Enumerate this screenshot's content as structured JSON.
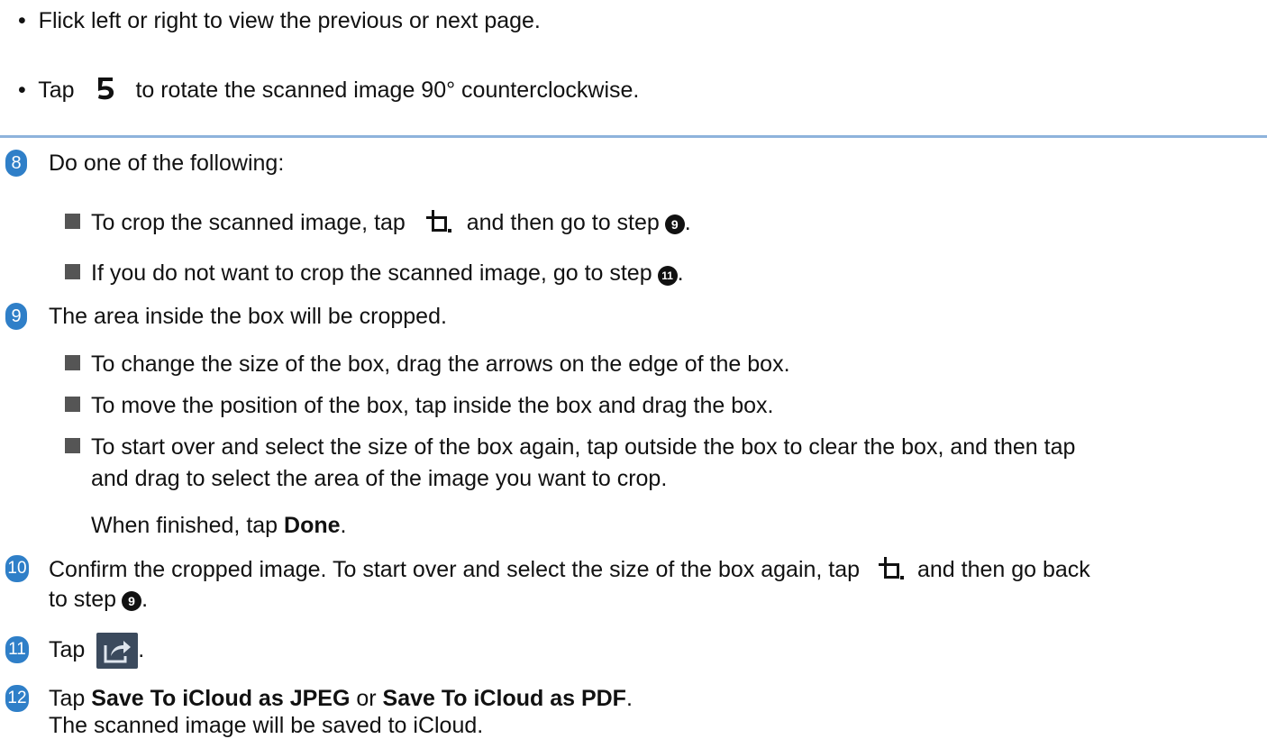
{
  "bullets": [
    {
      "prefix": "•",
      "text": "Flick left or right to view the previous or next page."
    },
    {
      "prefix": "•",
      "before": "Tap",
      "after": "to rotate the scanned image 90° counterclockwise.",
      "icon": "rotate-counterclockwise-icon"
    }
  ],
  "steps": {
    "s8": {
      "num": "8",
      "text": "Do one of the following:",
      "items": [
        {
          "before": "To crop the scanned image, tap",
          "middle": "and then go to step",
          "ref": "9",
          "end": "."
        },
        {
          "before": "If you do not want to crop the scanned image, go to step",
          "ref": "11",
          "end": "."
        }
      ]
    },
    "s9": {
      "num": "9",
      "text": "The area inside the box will be cropped.",
      "items": [
        "To change the size of the box, drag the arrows on the edge of the box.",
        "To move the position of the box, tap inside the box and drag the box.",
        "To start over and select the size of the box again, tap outside the box to clear the box, and then tap",
        "and drag to select the area of the image you want to crop."
      ],
      "finish_before": "When finished, tap",
      "finish_bold": "Done",
      "finish_end": "."
    },
    "s10": {
      "num": "10",
      "line1_before": "Confirm the cropped image. To start over and select the size of the box again, tap",
      "line1_after": "and then go back",
      "line2_before": "to step",
      "ref": "9",
      "end": "."
    },
    "s11": {
      "num": "11",
      "before": "Tap",
      "end": ".",
      "icon": "share-icon"
    },
    "s12": {
      "num": "12",
      "before": "Tap",
      "bold1": "Save To iCloud as JPEG",
      "or": "or",
      "bold2": "Save To iCloud as PDF",
      "end": ".",
      "line2": "The scanned image will be saved to iCloud."
    }
  },
  "colors": {
    "step_badge": "#2f7fc8",
    "rule": "#8eb3dc",
    "share_button": "#3b4a5d"
  }
}
